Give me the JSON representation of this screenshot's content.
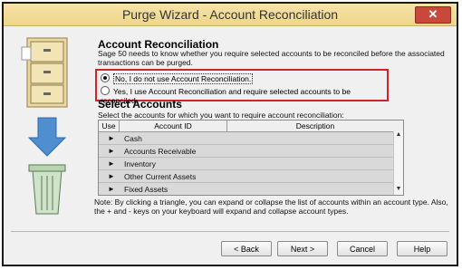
{
  "window": {
    "title": "Purge Wizard - Account Reconciliation",
    "close_label": "✕"
  },
  "section1": {
    "heading": "Account Reconciliation",
    "description": "Sage 50 needs to know whether you require selected accounts to be reconciled before the associated transactions can be purged."
  },
  "options": [
    {
      "label": "No, I do not use Account Reconciliation.",
      "selected": true
    },
    {
      "label": "Yes, I use Account Reconciliation and require selected accounts to be reconciled.",
      "selected": false
    }
  ],
  "section2": {
    "heading": "Select Accounts",
    "description": "Select the accounts for which you want to require account reconciliation:"
  },
  "grid": {
    "columns": [
      "Use",
      "Account ID",
      "Description"
    ],
    "rows": [
      "Cash",
      "Accounts Receivable",
      "Inventory",
      "Other Current Assets",
      "Fixed Assets"
    ]
  },
  "note": "Note: By clicking a triangle, you can expand or collapse the list of accounts within an account type. Also, the + and - keys on your keyboard will expand and collapse account types.",
  "buttons": {
    "back": "< Back",
    "next": "Next >",
    "cancel": "Cancel",
    "help": "Help"
  },
  "colors": {
    "highlight": "#d2232a",
    "titlebar": "#eed58a"
  }
}
